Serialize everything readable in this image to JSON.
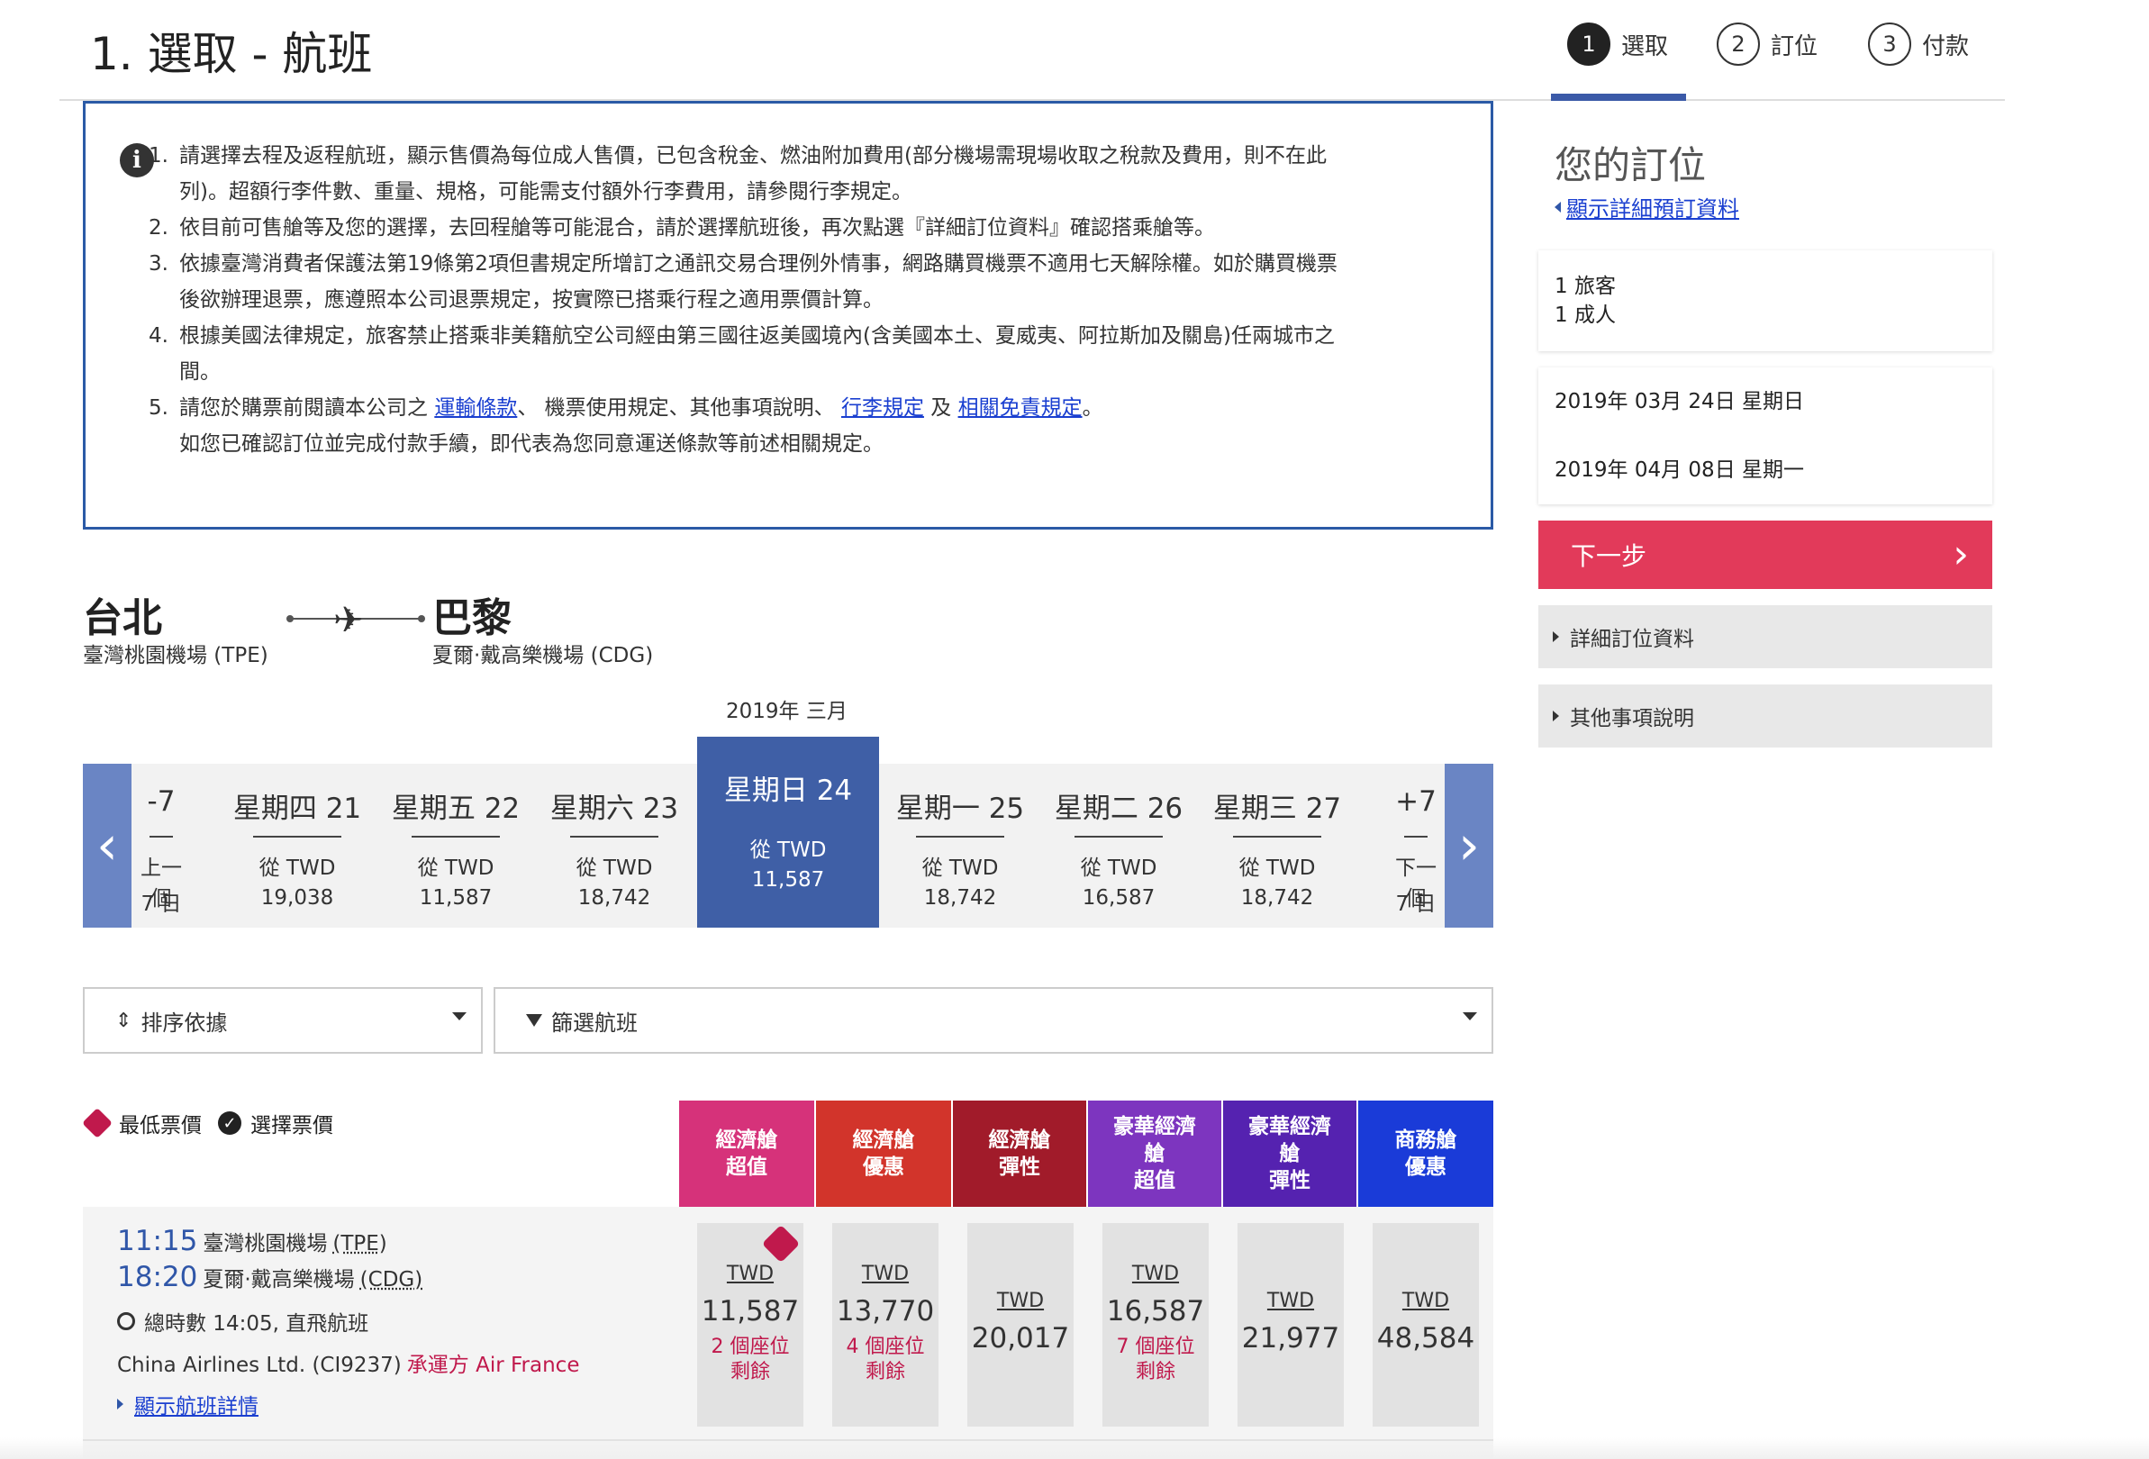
{
  "page": {
    "title": "1. 選取 - 航班"
  },
  "steps": [
    {
      "num": "1",
      "label": "選取"
    },
    {
      "num": "2",
      "label": "訂位"
    },
    {
      "num": "3",
      "label": "付款"
    }
  ],
  "info": {
    "icon": "info-icon",
    "items": [
      {
        "num": "1.",
        "lines": [
          "請選擇去程及返程航班，顯示售價為每位成人售價，已包含稅金、燃油附加費用(部分機場需現場收取之稅款及費用，則不在此",
          "列)。超額行李件數、重量、規格，可能需支付額外行李費用，請參閱行李規定。"
        ]
      },
      {
        "num": "2.",
        "lines": [
          "依目前可售艙等及您的選擇，去回程艙等可能混合，請於選擇航班後，再次點選『詳細訂位資料』確認搭乘艙等。"
        ]
      },
      {
        "num": "3.",
        "lines": [
          "依據臺灣消費者保護法第19條第2項但書規定所增訂之通訊交易合理例外情事，網路購買機票不適用七天解除權。如於購買機票",
          "後欲辦理退票，應遵照本公司退票規定，按實際已搭乘行程之適用票價計算。"
        ]
      },
      {
        "num": "4.",
        "lines": [
          "根據美國法律規定，旅客禁止搭乘非美籍航空公司經由第三國往返美國境內(含美國本土、夏威夷、阿拉斯加及關島)任兩城市之",
          "間。"
        ]
      }
    ],
    "item5": {
      "num": "5.",
      "prefix": "請您於購票前閱讀本公司之 ",
      "link1": "運輸條款",
      "mid1": "、 機票使用規定、其他事項說明、 ",
      "link2": "行李規定",
      "mid2": " 及 ",
      "link3": "相關免責規定",
      "suffix": "。",
      "line2": "如您已確認訂位並完成付款手續，即代表為您同意運送條款等前述相關規定。"
    }
  },
  "route": {
    "from_city": "台北",
    "from_airport": "臺灣桃園機場 (TPE)",
    "to_city": "巴黎",
    "to_airport": "夏爾·戴高樂機場 (CDG)"
  },
  "month": "2019年 三月",
  "dates": [
    {
      "day": "-7",
      "from": "上一個",
      "price": "7 日"
    },
    {
      "day": "星期四 21",
      "from": "從 TWD",
      "price": "19,038"
    },
    {
      "day": "星期五 22",
      "from": "從 TWD",
      "price": "11,587"
    },
    {
      "day": "星期六 23",
      "from": "從 TWD",
      "price": "18,742"
    },
    {
      "day": "星期日 24",
      "from": "從 TWD",
      "price": "11,587"
    },
    {
      "day": "星期一 25",
      "from": "從 TWD",
      "price": "18,742"
    },
    {
      "day": "星期二 26",
      "from": "從 TWD",
      "price": "16,587"
    },
    {
      "day": "星期三 27",
      "from": "從 TWD",
      "price": "18,742"
    },
    {
      "day": "+7",
      "from": "下一個",
      "price": "7 日"
    }
  ],
  "sort": {
    "label": "排序依據"
  },
  "filter": {
    "label": "篩選航班"
  },
  "legend": {
    "lowest": "最低票價",
    "selected": "選擇票價"
  },
  "fare_classes": [
    {
      "label": "經濟艙\n超值",
      "color": "#d6327a"
    },
    {
      "label": "經濟艙\n優惠",
      "color": "#d2342b"
    },
    {
      "label": "經濟艙\n彈性",
      "color": "#a11b2a"
    },
    {
      "label": "豪華經濟\n艙\n超值",
      "color": "#7d35bf"
    },
    {
      "label": "豪華經濟\n艙\n彈性",
      "color": "#5522b0"
    },
    {
      "label": "商務艙\n優惠",
      "color": "#1a3bd8"
    }
  ],
  "flight": {
    "dep_time": "11:15",
    "dep_airport": "臺灣桃園機場",
    "dep_code": "(TPE)",
    "arr_time": "18:20",
    "arr_airport": "夏爾·戴高樂機場",
    "arr_code": "(CDG)",
    "duration": "總時數 14:05, 直飛航班",
    "carrier": "China Airlines Ltd. (CI9237)",
    "operated_by": "承運方 Air France",
    "details_link": "顯示航班詳情",
    "fares": [
      {
        "currency": "TWD",
        "amount": "11,587",
        "seats": "2 個座位\n剩餘",
        "lowest": true
      },
      {
        "currency": "TWD",
        "amount": "13,770",
        "seats": "4 個座位\n剩餘",
        "lowest": false
      },
      {
        "currency": "TWD",
        "amount": "20,017",
        "seats": "",
        "lowest": false
      },
      {
        "currency": "TWD",
        "amount": "16,587",
        "seats": "7 個座位\n剩餘",
        "lowest": false
      },
      {
        "currency": "TWD",
        "amount": "21,977",
        "seats": "",
        "lowest": false
      },
      {
        "currency": "TWD",
        "amount": "48,584",
        "seats": "",
        "lowest": false
      }
    ]
  },
  "sidebar": {
    "title": "您的訂位",
    "details_link": "顯示詳細預訂資料",
    "passengers_line1": "1 旅客",
    "passengers_line2": "1 成人",
    "outbound_date": "2019年 03月 24日 星期日",
    "return_date": "2019年 04月 08日 星期一",
    "next_button": "下一步",
    "booking_details": "詳細訂位資料",
    "other_info": "其他事項說明"
  }
}
